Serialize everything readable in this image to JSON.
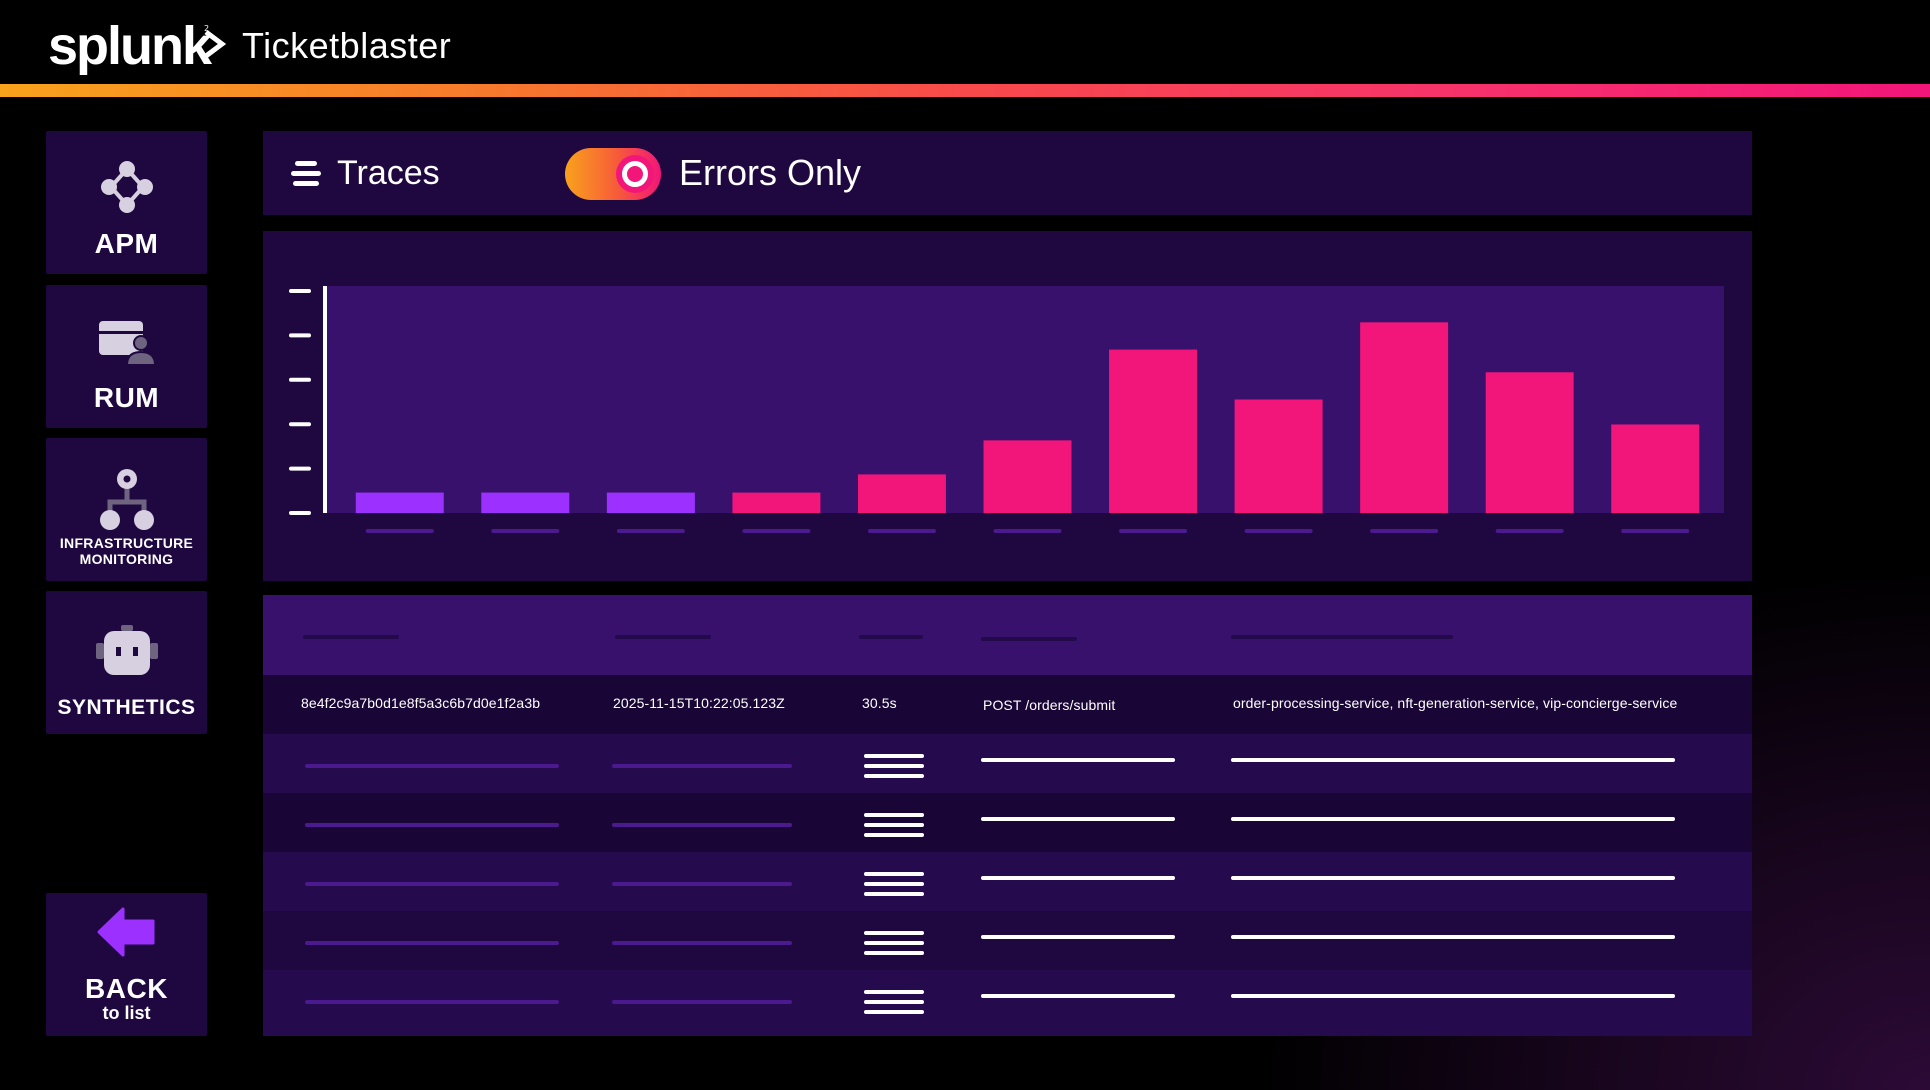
{
  "header": {
    "logo_text": "splunk",
    "app_title": "Ticketblaster"
  },
  "sidebar": {
    "items": [
      {
        "label": "APM",
        "icon": "apm-network-icon"
      },
      {
        "label": "RUM",
        "icon": "rum-user-browser-icon"
      },
      {
        "label": "INFRASTRUCTURE MONITORING",
        "label_line1": "INFRASTRUCTURE",
        "label_line2": "MONITORING",
        "icon": "infrastructure-hierarchy-icon"
      },
      {
        "label": "SYNTHETICS",
        "icon": "robot-icon"
      }
    ],
    "back": {
      "label": "BACK",
      "sublabel": "to list",
      "icon": "back-arrow-icon"
    }
  },
  "controls": {
    "traces_label": "Traces",
    "filter_icon": "filter-lines-icon",
    "toggle_label": "Errors Only",
    "toggle_on": true
  },
  "chart_data": {
    "type": "bar",
    "title": "",
    "xlabel": "",
    "ylabel": "",
    "ylim": [
      0,
      5
    ],
    "categories": [
      "",
      "",
      "",
      "",
      "",
      "",
      "",
      "",
      "",
      "",
      ""
    ],
    "values": [
      0.45,
      0.45,
      0.45,
      0.45,
      0.85,
      1.6,
      3.6,
      2.5,
      4.2,
      3.1,
      1.95
    ],
    "bar_colors": [
      "#9b30ff",
      "#9b30ff",
      "#9b30ff",
      "#f2157a",
      "#f2157a",
      "#f2157a",
      "#f2157a",
      "#f2157a",
      "#f2157a",
      "#f2157a",
      "#f2157a"
    ],
    "y_ticks": 6,
    "grid": false
  },
  "table": {
    "highlighted_row": {
      "trace_id": "8e4f2c9a7b0d1e8f5a3c6b7d0e1f2a3b",
      "timestamp": "2025-11-15T10:22:05.123Z",
      "duration": "30.5s",
      "operation": "POST /orders/submit",
      "services": "order-processing-service, nft-generation-service, vip-concierge-service"
    },
    "placeholder_rows": 5
  },
  "colors": {
    "panel": "#1f0840",
    "panel_dark": "#1a0636",
    "plot_bg": "#37116b",
    "purple_bar": "#9b30ff",
    "pink_bar": "#f2157a",
    "accent_start": "#f9a21c",
    "accent_end": "#f2157a"
  }
}
